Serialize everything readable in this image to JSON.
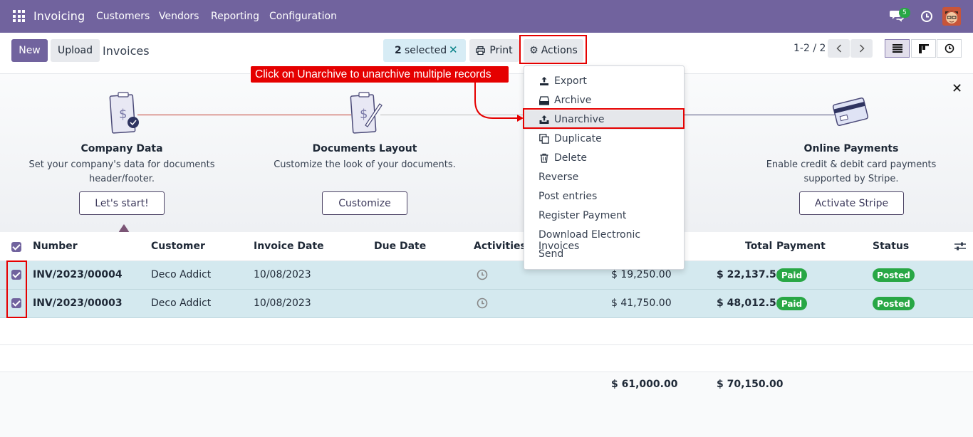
{
  "nav": {
    "brand": "Invoicing",
    "menu": [
      "Customers",
      "Vendors",
      "Reporting",
      "Configuration"
    ],
    "message_count": "5"
  },
  "control_panel": {
    "new_label": "New",
    "upload_label": "Upload",
    "title": "Invoices",
    "selected_count": "2",
    "selected_label": "selected",
    "print_label": "Print",
    "actions_label": "Actions",
    "pager": "1-2 / 2"
  },
  "callout": {
    "text": "Click on Unarchive to unarchive multiple records"
  },
  "actions_menu": {
    "items": [
      {
        "label": "Export",
        "icon": "export-icon"
      },
      {
        "label": "Archive",
        "icon": "archive-icon"
      },
      {
        "label": "Unarchive",
        "icon": "unarchive-icon",
        "highlighted": true
      },
      {
        "label": "Duplicate",
        "icon": "duplicate-icon"
      },
      {
        "label": "Delete",
        "icon": "trash-icon"
      },
      {
        "label": "Reverse"
      },
      {
        "label": "Post entries"
      },
      {
        "label": "Register Payment"
      },
      {
        "label": "Download Electronic Invoices"
      },
      {
        "label": "Send"
      }
    ]
  },
  "onboarding": {
    "steps": [
      {
        "title": "Company Data",
        "desc1": "Set your company's data for documents",
        "desc2": "header/footer.",
        "button": "Let's start!"
      },
      {
        "title": "Documents Layout",
        "desc1": "Customize the look of your documents.",
        "desc2": "",
        "button": "Customize"
      },
      {
        "title": "Online Payments",
        "desc1": "Enable credit & debit card payments",
        "desc2": "supported by Stripe.",
        "button": "Activate Stripe"
      }
    ]
  },
  "table": {
    "columns": [
      "Number",
      "Customer",
      "Invoice Date",
      "Due Date",
      "Activities",
      "Total",
      "Payment",
      "Status"
    ],
    "rows": [
      {
        "number": "INV/2023/00004",
        "customer": "Deco Addict",
        "invoice_date": "10/08/2023",
        "due_date": "",
        "untaxed": "$ 19,250.00",
        "total": "$ 22,137.50",
        "payment": "Paid",
        "status": "Posted"
      },
      {
        "number": "INV/2023/00003",
        "customer": "Deco Addict",
        "invoice_date": "10/08/2023",
        "due_date": "",
        "untaxed": "$ 41,750.00",
        "total": "$ 48,012.50",
        "payment": "Paid",
        "status": "Posted"
      }
    ],
    "footer": {
      "untaxed": "$ 61,000.00",
      "total": "$ 70,150.00"
    }
  },
  "colors": {
    "brand": "#71639e",
    "highlight_red": "#e50000",
    "paid": "#28a745",
    "row_selected": "#d4e9ef"
  }
}
